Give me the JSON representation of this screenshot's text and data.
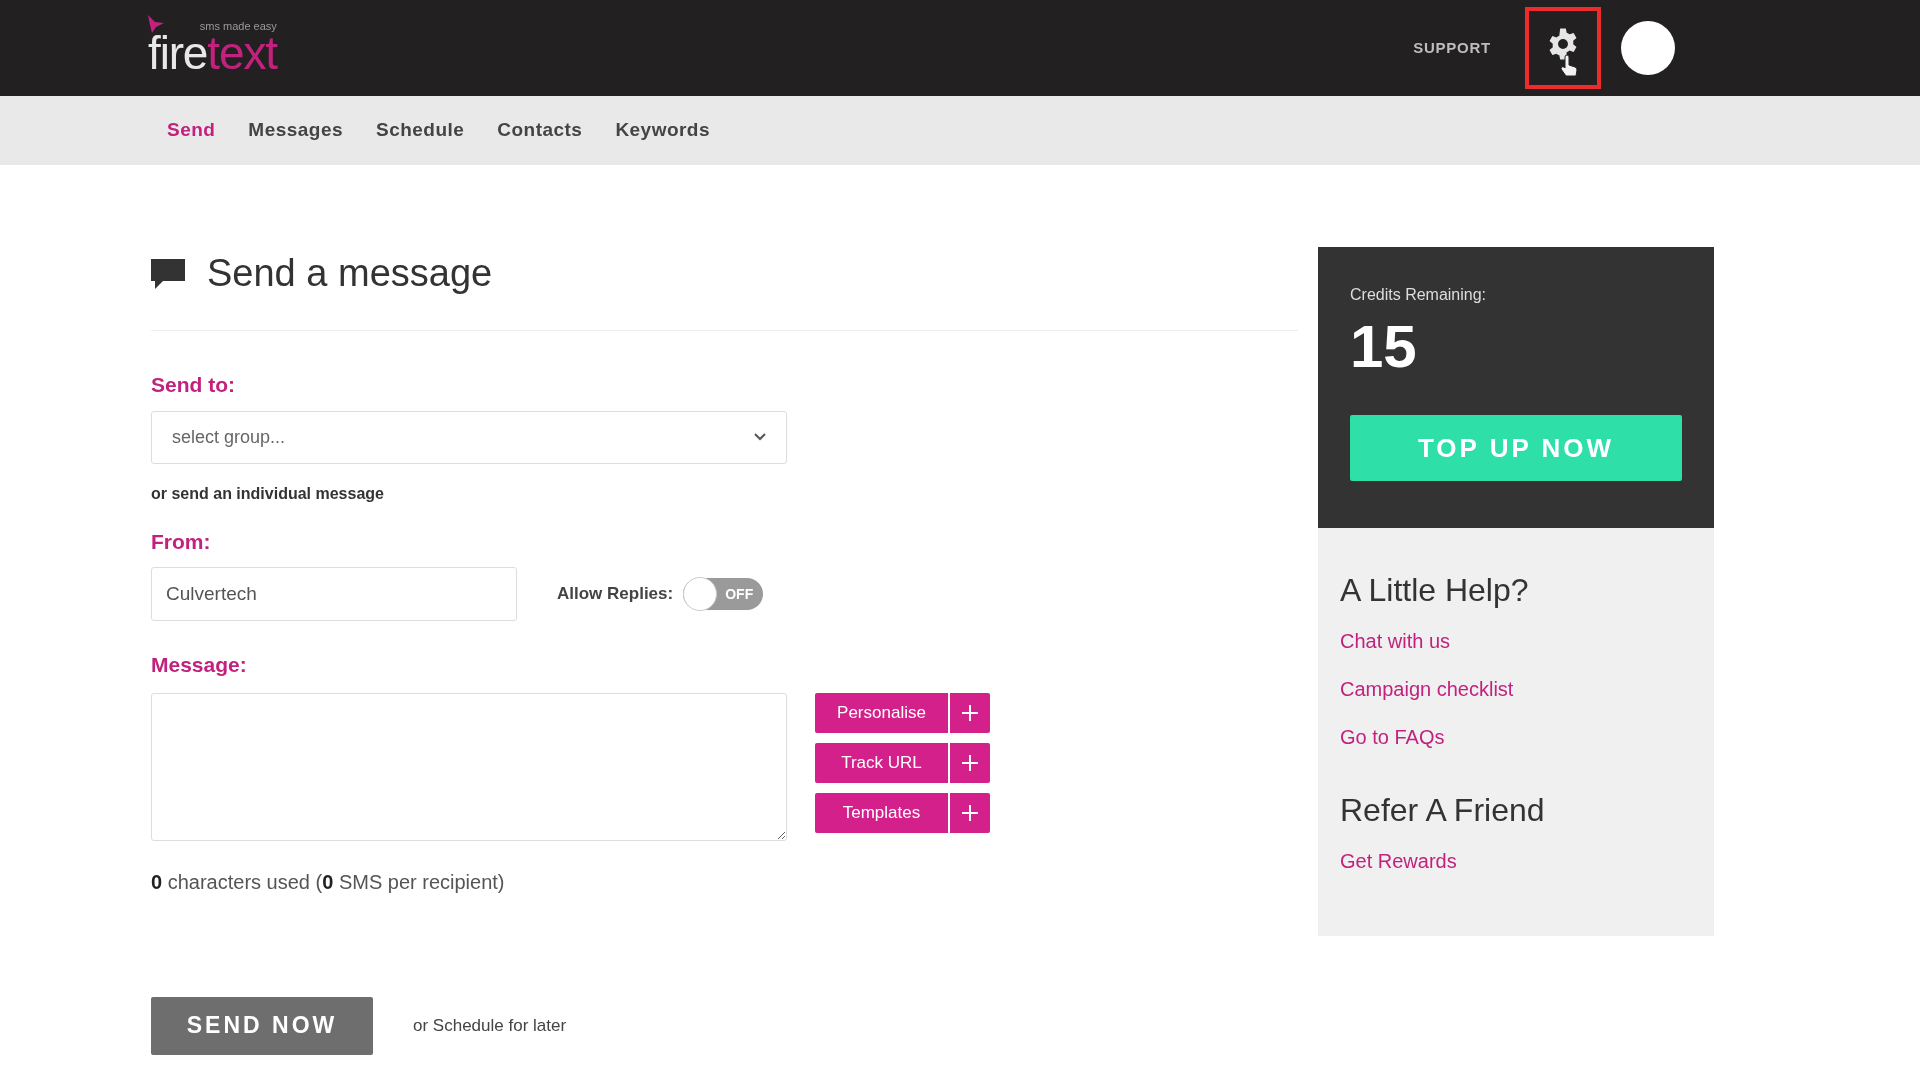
{
  "header": {
    "logo": {
      "tagline": "sms made easy",
      "word_1": "fire",
      "word_2": "text"
    },
    "support": "SUPPORT",
    "settings_highlighted": true
  },
  "nav": [
    {
      "label": "Send",
      "selected": true
    },
    {
      "label": "Messages",
      "selected": false
    },
    {
      "label": "Schedule",
      "selected": false
    },
    {
      "label": "Contacts",
      "selected": false
    },
    {
      "label": "Keywords",
      "selected": false
    }
  ],
  "page_title": "Send a message",
  "form": {
    "send_to_label": "Send to:",
    "group_placeholder": "select group...",
    "individual_link": "or send an individual message",
    "from_label": "From:",
    "from_value": "Culvertech",
    "allow_replies": {
      "label": "Allow Replies:",
      "on": false,
      "state_text": "OFF"
    },
    "message_label": "Message:",
    "tools": [
      "Personalise",
      "Track URL",
      "Templates"
    ],
    "counter": "**0** characters used (**0** SMS per recipient)",
    "send_button": "SEND NOW",
    "schedule_link": "or Schedule for later"
  },
  "sidebar": {
    "credits_label": "Credits Remaining:",
    "credits": "15",
    "top_up": "TOP UP NOW",
    "help_title": "A Little Help?",
    "help_links": [
      "Chat with us",
      "Campaign checklist",
      "Go to FAQs"
    ],
    "refer_title": "Refer A Friend",
    "refer_link": "Get Rewards"
  }
}
